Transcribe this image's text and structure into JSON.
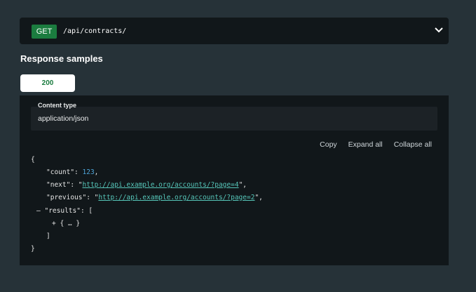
{
  "endpoint": {
    "method": "GET",
    "path": "/api/contracts/",
    "chevron_icon": "chevron-down-icon"
  },
  "responses": {
    "title": "Response samples",
    "status_tab": "200"
  },
  "content_type": {
    "label": "Content type",
    "value": "application/json"
  },
  "actions": {
    "copy": "Copy",
    "expand_all": "Expand all",
    "collapse_all": "Collapse all"
  },
  "json_sample": {
    "open_brace": "{",
    "close_brace": "}",
    "count_key": "\"count\"",
    "count_value": "123",
    "next_key": "\"next\"",
    "next_value": "http://api.example.org/accounts/?page=4",
    "previous_key": "\"previous\"",
    "previous_value": "http://api.example.org/accounts/?page=2",
    "results_key": "\"results\"",
    "results_open": "[",
    "results_item": "{ … }",
    "results_close": "]",
    "collapse_marker": "–",
    "expand_marker": "+"
  },
  "colors": {
    "page_bg": "#263238",
    "panel_bg": "#11171a",
    "get_badge": "#1b7c3f",
    "link": "#56c6b9",
    "number": "#4ea5d9"
  }
}
